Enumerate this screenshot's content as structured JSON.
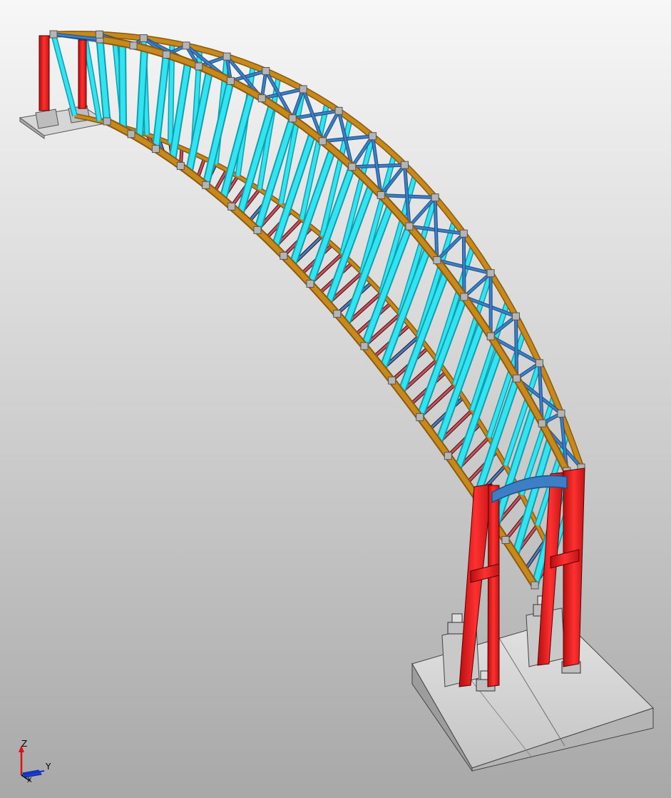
{
  "viewport": {
    "background_top": "#f7f7f7",
    "background_bottom": "#a8a8a8"
  },
  "model": {
    "colors": {
      "arch_chord": "#c8891c",
      "arch_chord_dark": "#8a5a0e",
      "hanger": "#33e4f0",
      "hanger_dark": "#0f9fb0",
      "bracing": "#3d7fc4",
      "bracing_dark": "#1e4f85",
      "floor_beam": "#c8505a",
      "floor_beam_dark": "#7a1f27",
      "portal_frame": "#ee2a2a",
      "portal_frame_dark": "#a00e0e",
      "concrete": "#cfcfcf",
      "concrete_dark": "#8f8f8f",
      "bearing": "#bfbfbf",
      "node_plate": "#b5b5b5"
    }
  },
  "axis_triad": {
    "z_label": "Z",
    "y_label": "Y",
    "x_label": "X",
    "z_color": "#e01010",
    "y_color": "#1030d0",
    "x_color": "#000000"
  }
}
